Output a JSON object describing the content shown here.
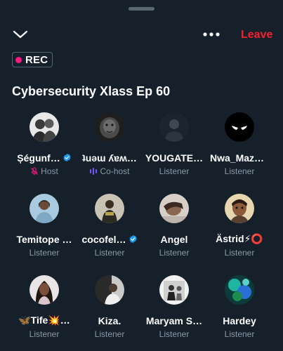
{
  "header": {
    "collapse_icon": "chevron-down-icon",
    "more_icon": "more-horizontal-icon",
    "leave_label": "Leave"
  },
  "recording": {
    "label": "REC",
    "dot_color": "#f91880"
  },
  "space": {
    "title": "Cybersecurity Xlass Ep 60"
  },
  "colors": {
    "background": "#15202b",
    "leave": "#f4212e",
    "muted_text": "#8b98a5",
    "verified": "#1d9bf0",
    "cohost_icon": "#7856ff",
    "host_mic_muted": "#f91880"
  },
  "participants": [
    {
      "name": "Șégunf…",
      "verified": true,
      "role": "Host",
      "role_icon": "mic-muted-icon"
    },
    {
      "name": "ʇuǝɯ ʎɐʍ…",
      "verified": false,
      "role": "Co-host",
      "role_icon": "speaking-bars-icon"
    },
    {
      "name": "YOUGATE…",
      "verified": false,
      "role": "Listener",
      "role_icon": ""
    },
    {
      "name": "Nwa_Mazz…",
      "verified": false,
      "role": "Listener",
      "role_icon": ""
    },
    {
      "name": "Temitope …",
      "verified": false,
      "role": "Listener",
      "role_icon": ""
    },
    {
      "name": "cocofel…",
      "verified": true,
      "role": "Listener",
      "role_icon": ""
    },
    {
      "name": "Angel",
      "verified": false,
      "role": "Listener",
      "role_icon": ""
    },
    {
      "name": "Ästrid⚡⭕",
      "verified": false,
      "role": "Listener",
      "role_icon": ""
    },
    {
      "name": "🦋Tife💥…",
      "verified": false,
      "role": "Listener",
      "role_icon": ""
    },
    {
      "name": "Kiza.",
      "verified": false,
      "role": "Listener",
      "role_icon": ""
    },
    {
      "name": "Maryam S…",
      "verified": false,
      "role": "Listener",
      "role_icon": ""
    },
    {
      "name": "Hardey",
      "verified": false,
      "role": "Listener",
      "role_icon": ""
    }
  ]
}
